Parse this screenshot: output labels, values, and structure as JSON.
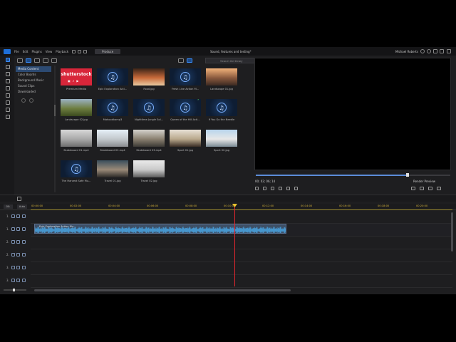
{
  "titlebar": {
    "menu": [
      "File",
      "Edit",
      "Plugins",
      "View",
      "Playback"
    ],
    "produce_label": "Produce",
    "project_title": "Sound, features and testing*",
    "user": "Michael Roberts"
  },
  "library": {
    "search_placeholder": "Search the library",
    "categories": [
      "Media Content",
      "Color Boards",
      "Background Music",
      "Sound Clips",
      "Downloaded"
    ],
    "selected_category": "Media Content",
    "items": [
      {
        "caption": "Premium Media",
        "kind": "shutterstock",
        "logo_text": "shutterstock"
      },
      {
        "caption": "Epic Exploration Acti...",
        "kind": "audio"
      },
      {
        "caption": "Food.jpg",
        "kind": "image",
        "colors": [
          "#3b2418",
          "#c86a3a",
          "#e9c9a0"
        ]
      },
      {
        "caption": "Fresh Line Action M...",
        "kind": "audio"
      },
      {
        "caption": "Landscape 01.jpg",
        "kind": "image",
        "colors": [
          "#f2b27a",
          "#8a5a3e",
          "#3c2a22"
        ]
      },
      {
        "caption": "Landscape 02.jpg",
        "kind": "image",
        "colors": [
          "#9bb2c4",
          "#6e7e40",
          "#3b4a1e"
        ]
      },
      {
        "caption": "Mahoodkamp3",
        "kind": "audio"
      },
      {
        "caption": "Nighttime Jungle Sol...",
        "kind": "audio"
      },
      {
        "caption": "Queen of the Hill Acti...",
        "kind": "audio",
        "checked": true
      },
      {
        "caption": "If You Go the Needle",
        "kind": "audio"
      },
      {
        "caption": "Skateboard 01.mp4",
        "kind": "image",
        "colors": [
          "#d8d8d8",
          "#a9a9a9",
          "#6f6f6f"
        ]
      },
      {
        "caption": "Skateboard 02.mp4",
        "kind": "image",
        "colors": [
          "#e6f0f8",
          "#c2c8cc",
          "#8a8c90"
        ]
      },
      {
        "caption": "Skateboard 03.mp4",
        "kind": "image",
        "colors": [
          "#d4d2cc",
          "#8a8070",
          "#3c3a36"
        ]
      },
      {
        "caption": "Sport 01.jpg",
        "kind": "image",
        "colors": [
          "#e7e1d6",
          "#b9a88c",
          "#3a2e26"
        ]
      },
      {
        "caption": "Sport 02.jpg",
        "kind": "image",
        "colors": [
          "#b8d4ec",
          "#e8e8e8",
          "#7a8a94"
        ]
      },
      {
        "caption": "The Harvest Safe Mu...",
        "kind": "audio"
      },
      {
        "caption": "Travel 01.jpg",
        "kind": "image",
        "colors": [
          "#3a4e5c",
          "#9a8a78",
          "#2a2826"
        ]
      },
      {
        "caption": "Travel 02.jpg",
        "kind": "image",
        "colors": [
          "#eaeaea",
          "#c9c9c9",
          "#5a5a5a"
        ]
      }
    ]
  },
  "preview": {
    "timecode": "00; 02; 06; 14",
    "render_label": "Render Preview",
    "scrub_progress": 0.78
  },
  "timeline": {
    "btn_a": "00:",
    "btn_b": "Auto",
    "ticks": [
      "00:00:00",
      "00:02:00",
      "00:04:00",
      "00:06:00",
      "00:08:00",
      "00:10:00",
      "00:12:00",
      "00:14:00",
      "00:16:00",
      "00:18:00",
      "00:20:00"
    ],
    "track_numbers": [
      "1.",
      "1.",
      "2.",
      "2.",
      "3.",
      "3."
    ],
    "clip_label": "Epic Exploration Action Mu..."
  },
  "colors": {
    "accent": "#3a8fff",
    "playhead": "#e0262e",
    "ruler": "#d9b63c"
  }
}
